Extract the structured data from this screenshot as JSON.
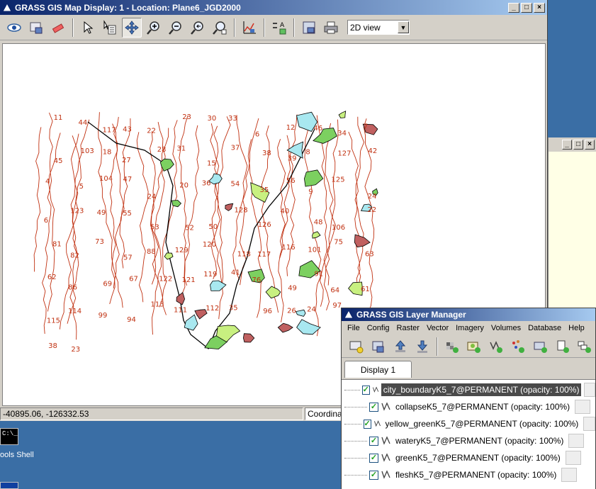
{
  "map_window": {
    "title": "GRASS GIS Map Display: 1 - Location: Plane6_JGD2000",
    "view_mode": "2D view",
    "status_coords": "-40895.06, -126332.53",
    "status_combo": "Coordinates",
    "toolbar_icons": [
      "eye-icon",
      "render-icon",
      "eraser-icon",
      "pointer-icon",
      "query-icon",
      "pan-icon",
      "zoom-in-icon",
      "zoom-out-icon",
      "zoom-back-icon",
      "zoom-menu-icon",
      "analyze-icon",
      "decoration-icon",
      "save-icon",
      "print-icon"
    ]
  },
  "map_labels": [
    "11",
    "44",
    "117",
    "43",
    "22",
    "23",
    "30",
    "33",
    "6",
    "12",
    "46",
    "34",
    "7",
    "45",
    "103",
    "18",
    "27",
    "28",
    "31",
    "15",
    "37",
    "38",
    "39",
    "8",
    "127",
    "42",
    "4",
    "5",
    "104",
    "47",
    "24",
    "20",
    "36",
    "54",
    "35",
    "56",
    "9",
    "125",
    "24",
    "6",
    "123",
    "49",
    "55",
    "53",
    "52",
    "50",
    "128",
    "126",
    "40",
    "48",
    "106",
    "22",
    "81",
    "82",
    "73",
    "57",
    "88",
    "129",
    "120",
    "118",
    "117",
    "116",
    "101",
    "75",
    "63",
    "62",
    "86",
    "69",
    "67",
    "122",
    "121",
    "119",
    "41",
    "76",
    "49",
    "91",
    "64",
    "61",
    "115",
    "114",
    "99",
    "94",
    "113",
    "111",
    "112",
    "35",
    "96",
    "26",
    "24",
    "97",
    "25",
    "38",
    "23"
  ],
  "desktop": {
    "shell_label": "ools Shell"
  },
  "layer_manager": {
    "title": "GRASS GIS Layer Manager",
    "menu": [
      "File",
      "Config",
      "Raster",
      "Vector",
      "Imagery",
      "Volumes",
      "Database",
      "Help"
    ],
    "tab": "Display 1",
    "layers": [
      {
        "label": "city_boundaryK5_7@PERMANENT (opacity: 100%)",
        "checked": true,
        "selected": true
      },
      {
        "label": "collapseK5_7@PERMANENT (opacity: 100%)",
        "checked": true,
        "selected": false
      },
      {
        "label": "yellow_greenK5_7@PERMANENT (opacity: 100%)",
        "checked": true,
        "selected": false
      },
      {
        "label": "wateryK5_7@PERMANENT (opacity: 100%)",
        "checked": true,
        "selected": false
      },
      {
        "label": "greenK5_7@PERMANENT (opacity: 100%)",
        "checked": true,
        "selected": false
      },
      {
        "label": "fleshK5_7@PERMANENT (opacity: 100%)",
        "checked": true,
        "selected": false
      }
    ]
  },
  "colors": {
    "contour": "#c03010",
    "water": "#a8e8f0",
    "green": "#7cd060",
    "yellow_green": "#c8f080",
    "collapse": "#c06060"
  }
}
